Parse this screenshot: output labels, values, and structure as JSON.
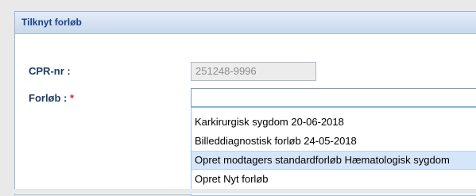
{
  "dialog": {
    "title": "Tilknyt forløb"
  },
  "form": {
    "cpr_label": "CPR-nr :",
    "cpr_value": "251248-9996",
    "forlob_label": "Forløb :",
    "required_mark": "*",
    "forlob_value": ""
  },
  "dropdown": {
    "items": [
      {
        "label": "Karkirurgisk sygdom 20-06-2018"
      },
      {
        "label": "Billeddiagnostisk forløb 24-05-2018"
      },
      {
        "label": "Opret modtagers standardforløb Hæmatologisk sygdom"
      },
      {
        "label": "Opret Nyt forløb"
      }
    ],
    "highlighted_index": 2
  },
  "colors": {
    "header_text": "#15428b",
    "label_text": "#1f3a66",
    "required": "#e0242a",
    "highlight": "#d6e6fa"
  }
}
